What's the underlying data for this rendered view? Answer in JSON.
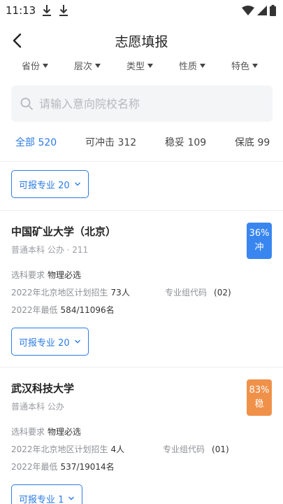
{
  "status": {
    "time": "11:13"
  },
  "header": {
    "title": "志愿填报"
  },
  "filters": [
    "省份",
    "层次",
    "类型",
    "性质",
    "特色"
  ],
  "search": {
    "placeholder": "请输入意向院校名称"
  },
  "categories": [
    {
      "label": "全部 520",
      "active": true
    },
    {
      "label": "可冲击 312",
      "active": false
    },
    {
      "label": "稳妥 109",
      "active": false
    },
    {
      "label": "保底 99",
      "active": false
    }
  ],
  "top_major_button": "可报专业 20",
  "schools": [
    {
      "name": "中国矿业大学（北京）",
      "meta": "普通本科 公办 · 211",
      "subject_label": "选科要求",
      "subject_value": "物理必选",
      "plan_label": "2022年北京地区计划招生",
      "plan_value": "73人",
      "group_label": "专业组代码",
      "group_value": "(02)",
      "min_label": "2022年最低",
      "min_value": "584/11096名",
      "badge_percent": "36%",
      "badge_label": "冲",
      "badge_color": "#3a86f0",
      "major_button": "可报专业 20"
    },
    {
      "name": "武汉科技大学",
      "meta": "普通本科 公办",
      "subject_label": "选科要求",
      "subject_value": "物理必选",
      "plan_label": "2022年北京地区计划招生",
      "plan_value": "4人",
      "group_label": "专业组代码",
      "group_value": "(01)",
      "min_label": "2022年最低",
      "min_value": "537/19014名",
      "badge_percent": "83%",
      "badge_label": "稳",
      "badge_color": "#f0914a",
      "major_button": "可报专业 1"
    }
  ]
}
